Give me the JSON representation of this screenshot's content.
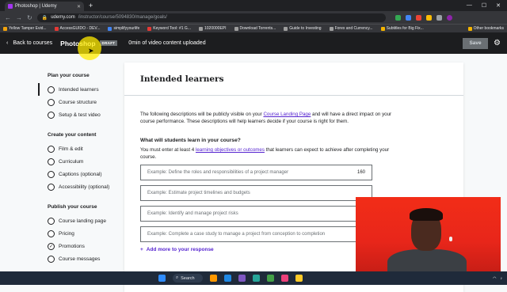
{
  "browser": {
    "tab_title": "Photoshop | Udemy",
    "url_domain": "udemy.com",
    "url_path": "/instructor/course/5094830/manage/goals/",
    "bookmarks": [
      {
        "label": "Yellow Tamper Evid...",
        "color": "#f1a20c"
      },
      {
        "label": "AccessGUIDO - DEV...",
        "color": "#e53935"
      },
      {
        "label": "simplifyyourlife",
        "color": "#4285f4"
      },
      {
        "label": "Keyword Tool: #1 G...",
        "color": "#e53935"
      },
      {
        "label": "1020000EPI",
        "color": "#9e9e9e"
      },
      {
        "label": "Download Torrents...",
        "color": "#9e9e9e"
      },
      {
        "label": "Guide to Investing",
        "color": "#9e9e9e"
      },
      {
        "label": "Forex and Currency...",
        "color": "#9e9e9e"
      },
      {
        "label": "Subtitles for Big Fix...",
        "color": "#f4b400"
      }
    ],
    "other_bookmarks": "Other bookmarks"
  },
  "header": {
    "back_label": "Back to courses",
    "course_title": "Photoshop",
    "draft_badge": "DRAFT",
    "upload_status": "0min of video content uploaded",
    "save_label": "Save"
  },
  "sidebar": {
    "sections": [
      {
        "title": "Plan your course",
        "items": [
          {
            "label": "Intended learners",
            "active": true
          },
          {
            "label": "Course structure"
          },
          {
            "label": "Setup & test video"
          }
        ]
      },
      {
        "title": "Create your content",
        "items": [
          {
            "label": "Film & edit"
          },
          {
            "label": "Curriculum"
          },
          {
            "label": "Captions (optional)"
          },
          {
            "label": "Accessibility (optional)"
          }
        ]
      },
      {
        "title": "Publish your course",
        "items": [
          {
            "label": "Course landing page"
          },
          {
            "label": "Pricing"
          },
          {
            "label": "Promotions",
            "checked": true
          },
          {
            "label": "Course messages"
          }
        ]
      }
    ]
  },
  "main": {
    "title": "Intended learners",
    "intro_1": "The following descriptions will be publicly visible on your ",
    "intro_link": "Course Landing Page",
    "intro_2": " and will have a direct impact on your course performance. These descriptions will help learners decide if your course is right for them.",
    "question": "What will students learn in your course?",
    "qdesc_1": "You must enter at least 4 ",
    "qdesc_link": "learning objectives or outcomes",
    "qdesc_2": " that learners can expect to achieve after completing your course.",
    "fields": [
      {
        "placeholder": "Example: Define the roles and responsibilities of a project manager",
        "count": "160"
      },
      {
        "placeholder": "Example: Estimate project timelines and budgets",
        "count": ""
      },
      {
        "placeholder": "Example: Identify and manage project risks",
        "count": ""
      },
      {
        "placeholder": "Example: Complete a case study to manage a project from conception to completion",
        "count": ""
      }
    ],
    "add_more": "Add more to your response"
  },
  "taskbar": {
    "search_label": "Search"
  }
}
